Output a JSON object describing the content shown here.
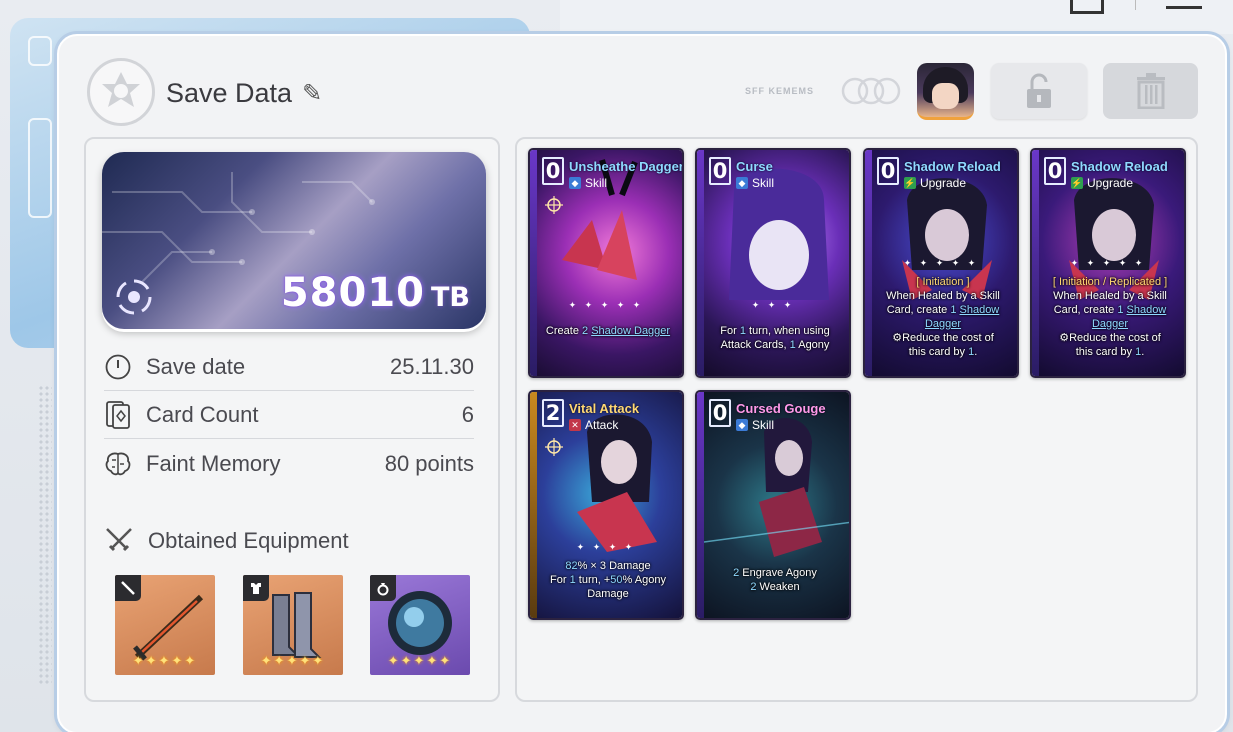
{
  "header": {
    "title": "Save Data",
    "tag": "SFF KEMEMS"
  },
  "banner": {
    "amount": "58010",
    "unit": "TB"
  },
  "stats": [
    {
      "label": "Save date",
      "value": "25.11.30",
      "icon": "clock-icon"
    },
    {
      "label": "Card Count",
      "value": "6",
      "icon": "cards-icon"
    },
    {
      "label": "Faint Memory",
      "value": "80 points",
      "icon": "brain-icon"
    }
  ],
  "equipment": {
    "title": "Obtained Equipment",
    "items": [
      {
        "slot": "weapon",
        "name": "sword",
        "stars": "✦✦✦✦✦",
        "color": "#c77a4c"
      },
      {
        "slot": "armor",
        "name": "boots",
        "stars": "✦✦✦✦✦",
        "color": "#c77a4c"
      },
      {
        "slot": "accessory",
        "name": "orb",
        "stars": "✦✦✦✦✦",
        "color": "#7b5cc0"
      }
    ]
  },
  "cards": [
    {
      "cost": "0",
      "name": "Unsheathe Dagger",
      "type": "Skill",
      "type_icon": "skill",
      "sparkle": "✦ ✦ ✦ ✦ ✦",
      "desc_a": "Create ",
      "desc_num": "2",
      "desc_hl": "Shadow Dagger"
    },
    {
      "cost": "0",
      "name": "Curse",
      "type": "Skill",
      "type_icon": "skill",
      "sparkle": "✦ ✦ ✦",
      "line1": "For ",
      "line1_num": "1",
      "line1_rest": " turn, when using",
      "line2": "Attack Cards, ",
      "line2_num": "1",
      "line2_rest": " Agony"
    },
    {
      "cost": "0",
      "name": "Shadow Reload",
      "type": "Upgrade",
      "type_icon": "upgrade",
      "sparkle": "✦ ✦ ✦ ✦ ✦",
      "keyword": "[ Initiation ]",
      "line1": "When Healed by a Skill",
      "line2a": "Card, create ",
      "line2_num": "1",
      "line2_hl": "Shadow",
      "line3_hl": "Dagger",
      "line4": "Reduce the cost of",
      "line5a": "this card by ",
      "line5_num": "1",
      "line5b": "."
    },
    {
      "cost": "0",
      "name": "Shadow Reload",
      "type": "Upgrade",
      "type_icon": "upgrade",
      "sparkle": "✦ ✦ ✦ ✦ ✦",
      "keyword": "[ Initiation / Replicated ]",
      "line1": "When Healed by a Skill",
      "line2a": "Card, create ",
      "line2_num": "1",
      "line2_hl": "Shadow",
      "line3_hl": "Dagger",
      "line4": "Reduce the cost of",
      "line5a": "this card by ",
      "line5_num": "1",
      "line5b": "."
    },
    {
      "cost": "2",
      "name": "Vital Attack",
      "type": "Attack",
      "type_icon": "attack",
      "sparkle": "✦ ✦ ✦ ✦",
      "line1_num": "82",
      "line1_rest": "% × 3 Damage",
      "line2": "For ",
      "line2_num": "1",
      "line2_mid": " turn, +",
      "line2_num2": "50",
      "line2_rest": "% Agony",
      "line3": "Damage"
    },
    {
      "cost": "0",
      "name": "Cursed Gouge",
      "type": "Skill",
      "type_icon": "skill",
      "line1_num": "2",
      "line1_rest": " Engrave Agony",
      "line2_num": "2",
      "line2_rest": " Weaken"
    }
  ],
  "colors": {
    "accent_blue": "#8fd9ff",
    "attack_gold": "#ffd873",
    "curse_pink": "#ff9ae8",
    "panel_border": "#b7cde6"
  }
}
